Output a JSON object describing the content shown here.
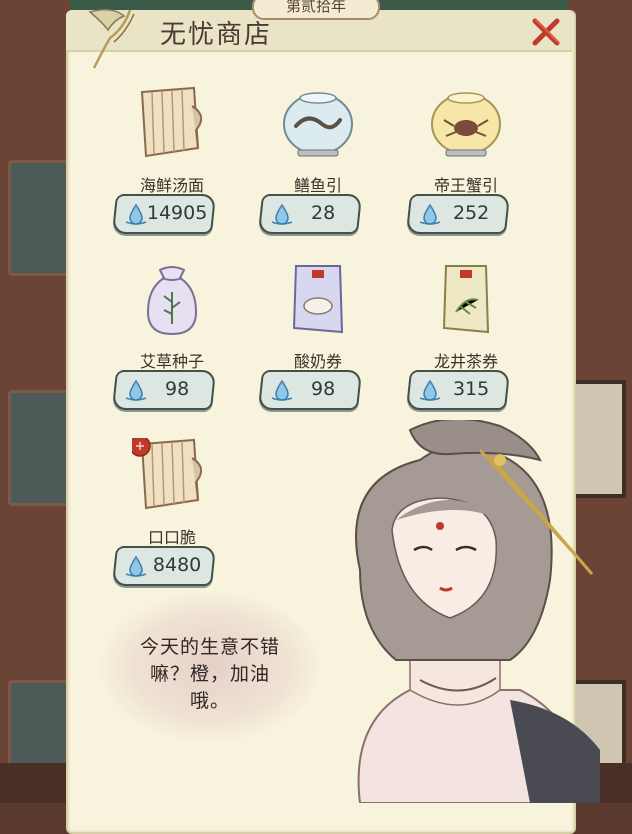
{
  "header": {
    "year_tab": "第贰拾年",
    "title": "无忧商店"
  },
  "items": [
    {
      "name": "海鲜汤面",
      "price": "14905",
      "icon": "scroll-recipe-icon"
    },
    {
      "name": "鳝鱼引",
      "price": "28",
      "icon": "eel-fishbowl-icon"
    },
    {
      "name": "帝王蟹引",
      "price": "252",
      "icon": "crab-fishbowl-icon"
    },
    {
      "name": "艾草种子",
      "price": "98",
      "icon": "seed-bag-icon"
    },
    {
      "name": "酸奶券",
      "price": "98",
      "icon": "yogurt-coupon-icon"
    },
    {
      "name": "龙井茶券",
      "price": "315",
      "icon": "tea-coupon-icon"
    },
    {
      "name": "口口脆",
      "price": "8480",
      "icon": "scroll-recipe-red-icon"
    }
  ],
  "dialog": {
    "line1": "今天的生意不错",
    "line2": "嘛？橙，加油",
    "line3": "哦。"
  },
  "currency_icon": "water-drop-icon",
  "colors": {
    "panel": "#f7f3dc",
    "price_bg": "#dde7e1",
    "accent_red": "#c0392b"
  }
}
